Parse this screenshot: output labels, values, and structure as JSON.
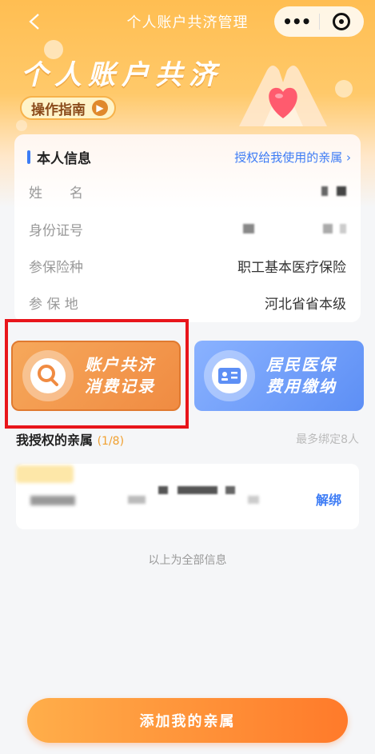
{
  "navbar": {
    "title": "个人账户共济管理",
    "back_icon": "chevron-left-icon",
    "more_icon": "more-dots-icon",
    "close_icon": "target-icon"
  },
  "hero": {
    "title": "个人账户共济",
    "guide_label": "操作指南"
  },
  "info_card": {
    "title": "本人信息",
    "link": "授权给我使用的亲属",
    "rows": [
      {
        "label": "姓　　名",
        "value": ""
      },
      {
        "label": "身份证号",
        "value": ""
      },
      {
        "label": "参保险种",
        "value": "职工基本医疗保险"
      },
      {
        "label": "参 保 地",
        "value": "河北省省本级"
      }
    ]
  },
  "tiles": {
    "left": {
      "line1": "账户共济",
      "line2": "消费记录",
      "icon": "search-icon"
    },
    "right": {
      "line1": "居民医保",
      "line2": "费用缴纳",
      "icon": "id-card-icon"
    }
  },
  "relatives": {
    "title": "我授权的亲属",
    "count": "(1/8)",
    "hint": "最多绑定8人",
    "unbind_label": "解绑"
  },
  "end_text": "以上为全部信息",
  "add_button": "添加我的亲属",
  "colors": {
    "accent_blue": "#3d7cf5",
    "accent_orange": "#ff7a2a",
    "highlight_red": "#e8151b"
  }
}
